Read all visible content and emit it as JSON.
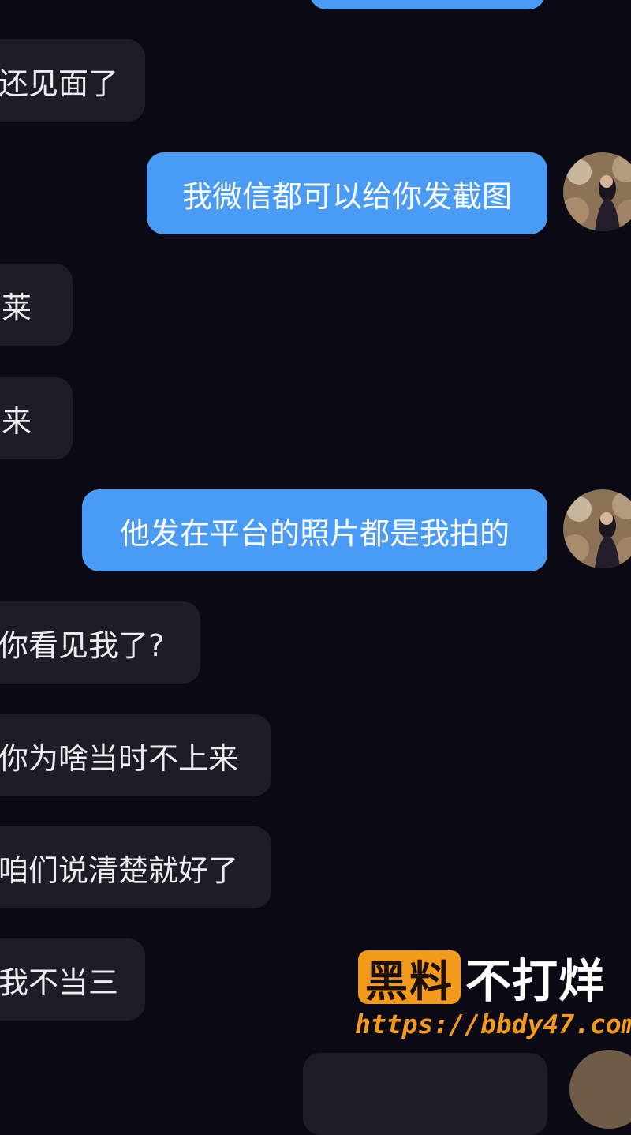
{
  "messages": [
    {
      "side": "in",
      "text": "还见面了"
    },
    {
      "side": "out",
      "text": "我微信都可以给你发截图"
    },
    {
      "side": "in",
      "text": "莱"
    },
    {
      "side": "in",
      "text": "来"
    },
    {
      "side": "out",
      "text": "他发在平台的照片都是我拍的"
    },
    {
      "side": "in",
      "text": "你看见我了?"
    },
    {
      "side": "in",
      "text": "你为啥当时不上来"
    },
    {
      "side": "in",
      "text": "咱们说清楚就好了"
    },
    {
      "side": "in",
      "text": "我不当三"
    }
  ],
  "watermark": {
    "badge": "黑料",
    "title": "不打烊",
    "url": "https://bbdy47.com"
  },
  "colors": {
    "background": "#0b0a14",
    "incoming_bubble": "#1e1d27",
    "outgoing_bubble": "#4a9bf5",
    "watermark_accent": "#f39a1c"
  },
  "icons": [
    "avatar-photo"
  ]
}
